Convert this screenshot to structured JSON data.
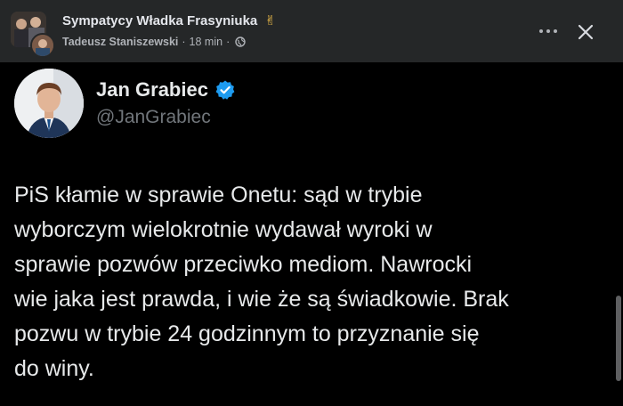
{
  "post_header": {
    "group_name": "Sympatycy Władka Frasyniuka",
    "group_emoji": "✌",
    "author": "Tadeusz Staniszewski",
    "separator": "·",
    "time": "18 min",
    "separator2": "·",
    "privacy_icon": "globe-icon",
    "more_icon": "more-horizontal-icon",
    "close_icon": "close-icon"
  },
  "tweet": {
    "name": "Jan Grabiec",
    "verified_icon": "verified-badge-icon",
    "verified_color": "#1d9bf0",
    "handle": "@JanGrabiec",
    "lines": [
      "PiS kłamie w sprawie Onetu: sąd w trybie",
      "wyborczym wielokrotnie wydawał wyroki w",
      "sprawie pozwów przeciwko mediom. Nawrocki",
      "wie jaka jest prawda, i wie że są świadkowie. Brak",
      "pozwu w trybie 24 godzinnym to przyznanie się",
      "do winy."
    ]
  },
  "colors": {
    "header_bg": "#252728",
    "page_bg": "#000000",
    "text_primary": "#e7e9ea",
    "text_secondary": "#71767b"
  }
}
